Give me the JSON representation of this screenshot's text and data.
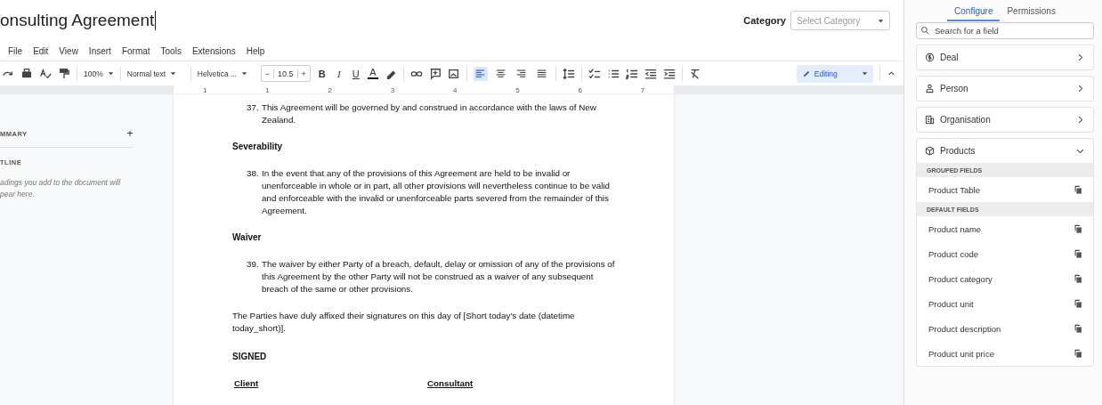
{
  "document": {
    "title": "onsulting Agreement",
    "category_label": "Category",
    "category_select": {
      "placeholder": "Select Category"
    },
    "menu": [
      "File",
      "Edit",
      "View",
      "Insert",
      "Format",
      "Tools",
      "Extensions",
      "Help"
    ],
    "toolbar": {
      "zoom": "100%",
      "style": "Normal text",
      "font": "Helvetica ...",
      "minus": "−",
      "font_size": "10.5",
      "plus": "+",
      "bold": "B",
      "italic": "I",
      "underline": "U",
      "text_color": "A",
      "alignment": [
        {
          "selected": true
        },
        {
          "selected": false
        },
        {
          "selected": false
        },
        {
          "selected": false
        }
      ],
      "mode": "Editing"
    },
    "ruler": [
      "1",
      "1",
      "2",
      "3",
      "4",
      "5",
      "6",
      "7"
    ],
    "outline_panel": {
      "summary": "MMARY",
      "summary_add": "+",
      "outline": "TLINE",
      "hint": "adings you add to the document will pear here."
    },
    "content": [
      {
        "kind": "item",
        "number": "37.",
        "text": "This Agreement will be governed by and construed in accordance with the laws of New Zealand."
      },
      {
        "kind": "heading",
        "text": "Severability"
      },
      {
        "kind": "item",
        "number": "38.",
        "text": "In the event that any of the provisions of this Agreement are held to be invalid or unenforceable in whole or in part, all other provisions will nevertheless continue to be valid and enforceable with the invalid or unenforceable parts severed from the remainder of this Agreement."
      },
      {
        "kind": "heading",
        "text": "Waiver"
      },
      {
        "kind": "item",
        "number": "39.",
        "text": "The waiver by either Party of a breach, default, delay or omission of any of the provisions of this Agreement by the other Party will not be construed as a waiver of any subsequent breach of the same or other provisions."
      },
      {
        "kind": "paragraph",
        "text": "The Parties have duly affixed their signatures on this day of [Short today's date (datetime today_short)]."
      },
      {
        "kind": "heading",
        "text": "SIGNED"
      },
      {
        "kind": "signatures",
        "parties": [
          "Client",
          "Consultant"
        ]
      }
    ]
  },
  "fields_panel": {
    "tabs": [
      {
        "label": "Configure",
        "selected": true
      },
      {
        "label": "Permissions",
        "selected": false
      }
    ],
    "search": {
      "placeholder": "Search for a field"
    },
    "sections": [
      {
        "kind": "deal",
        "label": "Deal",
        "expanded": false
      },
      {
        "kind": "person",
        "label": "Person",
        "expanded": false
      },
      {
        "kind": "organisation",
        "label": "Organisation",
        "expanded": false
      },
      {
        "kind": "products",
        "label": "Products",
        "expanded": true,
        "groups": [
          {
            "title": "GROUPED FIELDS",
            "fields": [
              "Product Table"
            ]
          },
          {
            "title": "DEFAULT FIELDS",
            "fields": [
              "Product name",
              "Product code",
              "Product category",
              "Product unit",
              "Product description",
              "Product unit price"
            ]
          }
        ]
      }
    ]
  }
}
